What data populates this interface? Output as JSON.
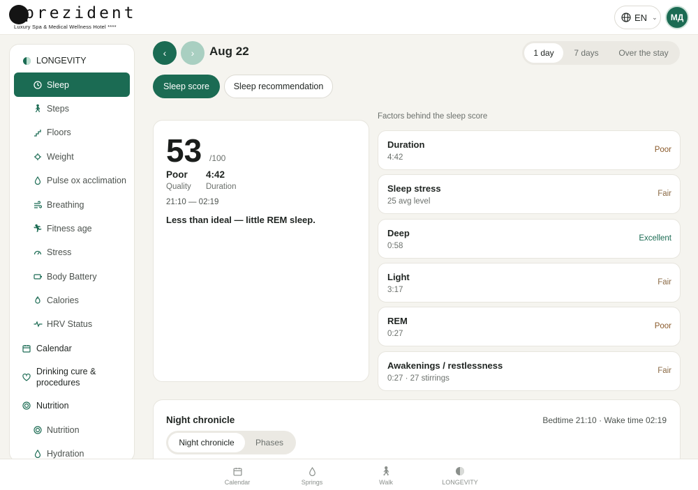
{
  "brand": {
    "name": "prezident",
    "tagline": "Luxury Spa & Medical Wellness Hotel",
    "stars": "****"
  },
  "header": {
    "language": "EN",
    "avatar_initials": "МД"
  },
  "sidebar": {
    "items": [
      {
        "label": "LONGEVITY",
        "icon": "longevity-icon",
        "level": "top"
      },
      {
        "label": "Sleep",
        "icon": "clock-icon",
        "level": "sub",
        "active": true
      },
      {
        "label": "Steps",
        "icon": "walking-icon",
        "level": "sub"
      },
      {
        "label": "Floors",
        "icon": "stairs-icon",
        "level": "sub"
      },
      {
        "label": "Weight",
        "icon": "weight-icon",
        "level": "sub"
      },
      {
        "label": "Pulse ox acclimation",
        "icon": "drop-icon",
        "level": "sub"
      },
      {
        "label": "Breathing",
        "icon": "wind-icon",
        "level": "sub"
      },
      {
        "label": "Fitness age",
        "icon": "running-icon",
        "level": "sub"
      },
      {
        "label": "Stress",
        "icon": "gauge-icon",
        "level": "sub"
      },
      {
        "label": "Body Battery",
        "icon": "battery-icon",
        "level": "sub"
      },
      {
        "label": "Calories",
        "icon": "flame-icon",
        "level": "sub"
      },
      {
        "label": "HRV Status",
        "icon": "pulse-icon",
        "level": "sub"
      },
      {
        "label": "Calendar",
        "icon": "calendar-icon",
        "level": "top"
      },
      {
        "label": "Drinking cure & procedures",
        "icon": "heart-icon",
        "level": "top"
      },
      {
        "label": "Nutrition",
        "icon": "target-icon",
        "level": "top"
      },
      {
        "label": "Nutrition",
        "icon": "target-icon",
        "level": "sub"
      },
      {
        "label": "Hydration",
        "icon": "drop-icon",
        "level": "sub"
      }
    ]
  },
  "toolbar": {
    "prev": "‹",
    "next": "›",
    "date": "Aug 22",
    "ranges": [
      "1 day",
      "7 days",
      "Over the stay"
    ],
    "active_range": "1 day",
    "tabs": [
      "Sleep score",
      "Sleep recommendation"
    ],
    "active_tab": "Sleep score"
  },
  "score": {
    "value": "53",
    "max": "/100",
    "quality_value": "Poor",
    "quality_label": "Quality",
    "duration_value": "4:42",
    "duration_label": "Duration",
    "time_range": "21:10 — 02:19",
    "summary": "Less than ideal — little REM sleep."
  },
  "factors": {
    "title": "Factors behind the sleep score",
    "items": [
      {
        "name": "Duration",
        "detail": "4:42",
        "rating": "Poor",
        "rating_color": "#8a5a2b"
      },
      {
        "name": "Sleep stress",
        "detail": "25 avg level",
        "rating": "Fair",
        "rating_color": "#8a6a45"
      },
      {
        "name": "Deep",
        "detail": "0:58",
        "rating": "Excellent",
        "rating_color": "#1b6b53"
      },
      {
        "name": "Light",
        "detail": "3:17",
        "rating": "Fair",
        "rating_color": "#8a6a45"
      },
      {
        "name": "REM",
        "detail": "0:27",
        "rating": "Poor",
        "rating_color": "#8a5a2b"
      },
      {
        "name": "Awakenings / restlessness",
        "detail": "0:27 · 27 stirrings",
        "rating": "Fair",
        "rating_color": "#8a6a45"
      }
    ]
  },
  "night": {
    "title": "Night chronicle",
    "meta": "Bedtime 21:10 · Wake time 02:19",
    "segments": [
      "Night chronicle",
      "Phases"
    ],
    "active_segment": "Night chronicle"
  },
  "bottom_nav": {
    "items": [
      {
        "label": "Calendar",
        "icon": "calendar-icon"
      },
      {
        "label": "Springs",
        "icon": "drop-icon"
      },
      {
        "label": "Walk",
        "icon": "walking-icon"
      },
      {
        "label": "LONGEVITY",
        "icon": "longevity-icon"
      }
    ]
  },
  "colors": {
    "accent": "#1b6b53",
    "accent_light": "#a9cfc1",
    "background": "#f5f4ef"
  }
}
